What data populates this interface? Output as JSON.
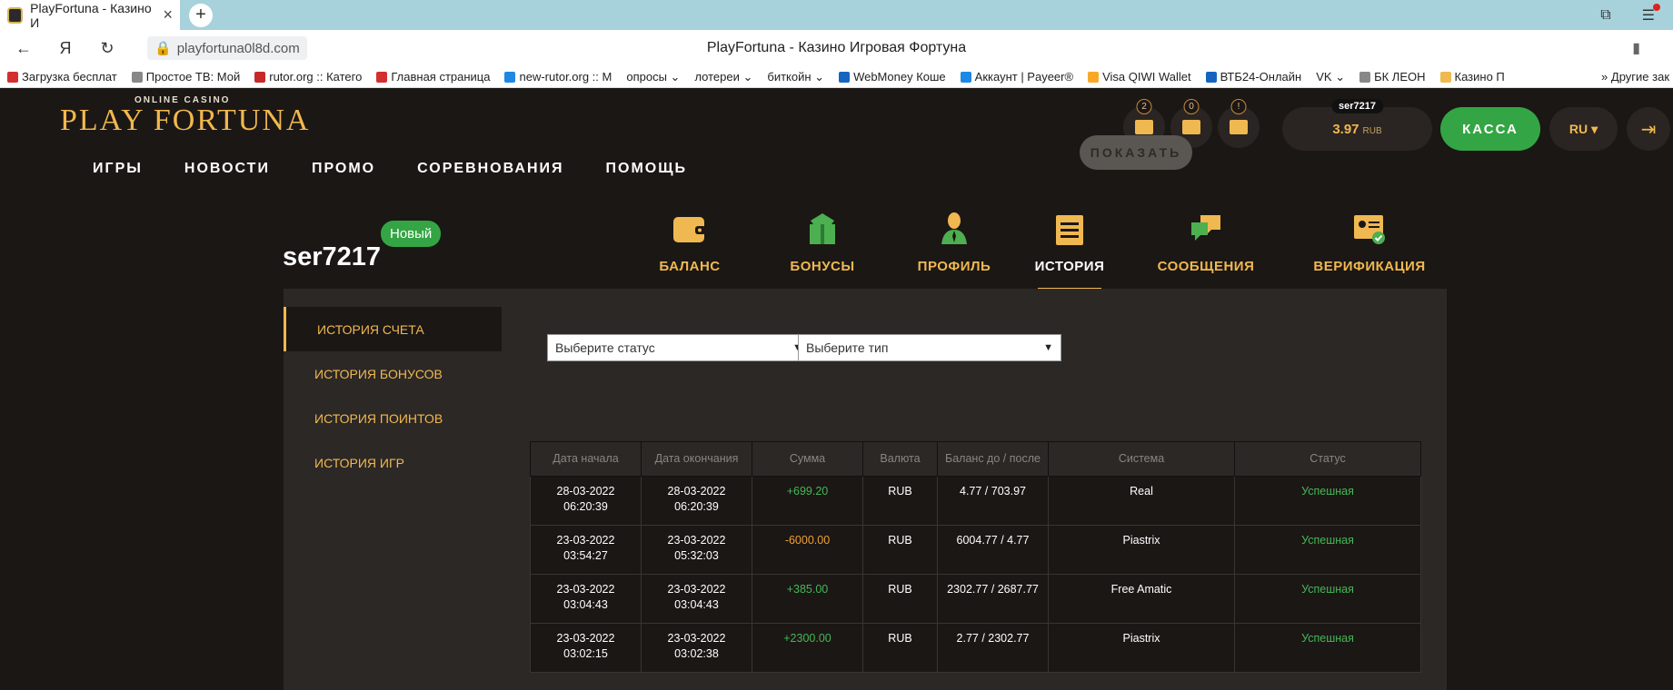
{
  "browser": {
    "tab_title": "PlayFortuna - Казино И",
    "url": "playfortuna0l8d.com",
    "page_title": "PlayFortuna - Казино Игровая Фортуна",
    "bookmarks": [
      {
        "label": "Загрузка бесплат",
        "color": "#d32f2f"
      },
      {
        "label": "Простое ТВ: Мой",
        "color": "#888888"
      },
      {
        "label": "rutor.org :: Катего",
        "color": "#c62828"
      },
      {
        "label": "Главная страница",
        "color": "#d32f2f"
      },
      {
        "label": "new-rutor.org :: M",
        "color": "#1e88e5"
      },
      {
        "label": "опросы ⌄",
        "color": ""
      },
      {
        "label": "лотереи ⌄",
        "color": ""
      },
      {
        "label": "биткойн ⌄",
        "color": ""
      },
      {
        "label": "WebMoney Коше",
        "color": "#1565c0"
      },
      {
        "label": "Аккаунт | Payeer®",
        "color": "#1e88e5"
      },
      {
        "label": "Visa QIWI Wallet",
        "color": "#f9a825"
      },
      {
        "label": "ВТБ24-Онлайн",
        "color": "#1565c0"
      },
      {
        "label": "VK ⌄",
        "color": ""
      },
      {
        "label": "БК ЛЕОН",
        "color": "#888888"
      },
      {
        "label": "Казино П",
        "color": "#f0b850"
      }
    ],
    "other_bookmarks": "» Другие зак"
  },
  "site": {
    "logo_small": "ONLINE CASINO",
    "logo_big": "PLAY FORTUNA",
    "nav": [
      "ИГРЫ",
      "НОВОСТИ",
      "ПРОМО",
      "СОРЕВНОВАНИЯ",
      "ПОМОЩЬ"
    ],
    "badges": {
      "gifts": "2",
      "messages": "0",
      "tasks": "!"
    },
    "user": "ser7217",
    "balance": "3.97",
    "currency": "RUB",
    "kassa": "КАССА",
    "lang": "RU"
  },
  "profile": {
    "username": "ser7217",
    "status_badge": "Новый",
    "tabs": [
      "БАЛАНС",
      "БОНУСЫ",
      "ПРОФИЛЬ",
      "ИСТОРИЯ",
      "СООБЩЕНИЯ",
      "ВЕРИФИКАЦИЯ"
    ],
    "active_tab": "ИСТОРИЯ"
  },
  "history": {
    "side": [
      "ИСТОРИЯ СЧЕТА",
      "ИСТОРИЯ БОНУСОВ",
      "ИСТОРИЯ ПОИНТОВ",
      "ИСТОРИЯ ИГР"
    ],
    "status_placeholder": "Выберите статус",
    "type_placeholder": "Выберите тип",
    "show_button": "ПОКАЗАТЬ",
    "columns": [
      "Дата начала",
      "Дата окончания",
      "Сумма",
      "Валюта",
      "Баланс до / после",
      "Система",
      "Статус"
    ],
    "rows": [
      {
        "start": "28-03-2022 06:20:39",
        "end": "28-03-2022 06:20:39",
        "amount": "+699.20",
        "currency": "RUB",
        "balance": "4.77 / 703.97",
        "system": "Real",
        "status": "Успешная"
      },
      {
        "start": "23-03-2022 03:54:27",
        "end": "23-03-2022 05:32:03",
        "amount": "-6000.00",
        "currency": "RUB",
        "balance": "6004.77 / 4.77",
        "system": "Piastrix",
        "status": "Успешная"
      },
      {
        "start": "23-03-2022 03:04:43",
        "end": "23-03-2022 03:04:43",
        "amount": "+385.00",
        "currency": "RUB",
        "balance": "2302.77 / 2687.77",
        "system": "Free Amatic",
        "status": "Успешная"
      },
      {
        "start": "23-03-2022 03:02:15",
        "end": "23-03-2022 03:02:38",
        "amount": "+2300.00",
        "currency": "RUB",
        "balance": "2.77 / 2302.77",
        "system": "Piastrix",
        "status": "Успешная"
      }
    ]
  }
}
